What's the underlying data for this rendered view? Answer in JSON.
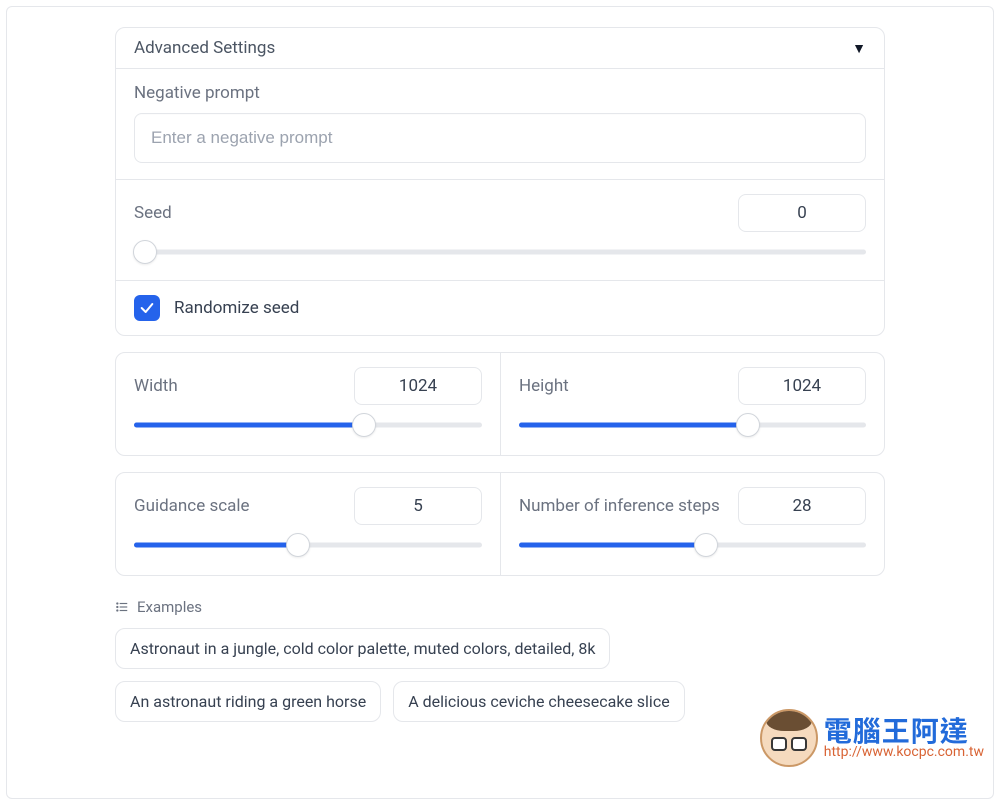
{
  "advanced": {
    "title": "Advanced Settings",
    "negative_prompt": {
      "label": "Negative prompt",
      "placeholder": "Enter a negative prompt",
      "value": ""
    },
    "seed": {
      "label": "Seed",
      "value": "0",
      "fill_pct": 0,
      "thumb_pct": 1.5
    },
    "randomize": {
      "label": "Randomize seed",
      "checked": true
    },
    "width": {
      "label": "Width",
      "value": "1024",
      "fill_pct": 66,
      "thumb_pct": 66
    },
    "height": {
      "label": "Height",
      "value": "1024",
      "fill_pct": 66,
      "thumb_pct": 66
    },
    "guidance": {
      "label": "Guidance scale",
      "value": "5",
      "fill_pct": 47,
      "thumb_pct": 47
    },
    "steps": {
      "label": "Number of inference steps",
      "value": "28",
      "fill_pct": 54,
      "thumb_pct": 54
    }
  },
  "examples": {
    "title": "Examples",
    "items": [
      "Astronaut in a jungle, cold color palette, muted colors, detailed, 8k",
      "An astronaut riding a green horse",
      "A delicious ceviche cheesecake slice"
    ]
  },
  "watermark": {
    "text_cn": "電腦王阿達",
    "url": "http://www.kocpc.com.tw"
  }
}
